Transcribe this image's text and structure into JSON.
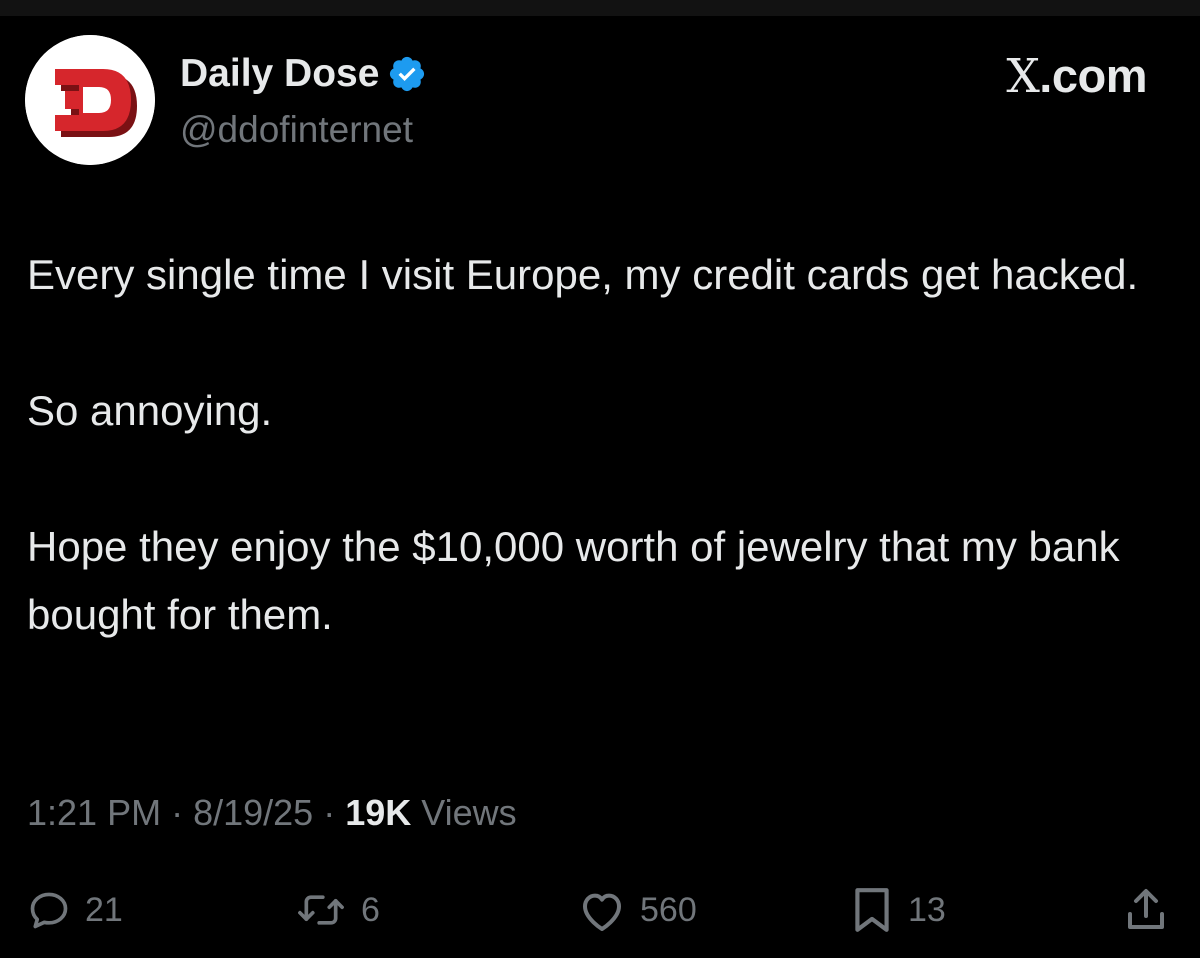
{
  "author": {
    "display_name": "Daily Dose",
    "handle": "@ddofinternet",
    "avatar_icon": "daily-dose-logo",
    "verified_icon": "verified-badge-icon",
    "verified_color": "#1d9bf0"
  },
  "brand": {
    "glyph": "X",
    "suffix": ".com"
  },
  "tweet": {
    "paragraphs": [
      "Every single time I visit Europe, my credit cards get hacked.",
      "So annoying.",
      "Hope they enjoy the $10,000 worth of jewelry that my bank bought for them."
    ]
  },
  "meta": {
    "time": "1:21 PM",
    "separator": " · ",
    "date": "8/19/25",
    "views_count": "19K",
    "views_label": " Views"
  },
  "actions": {
    "reply": {
      "icon": "reply-icon",
      "count": "21"
    },
    "repost": {
      "icon": "repost-icon",
      "count": "6"
    },
    "like": {
      "icon": "like-icon",
      "count": "560"
    },
    "bookmark": {
      "icon": "bookmark-icon",
      "count": "13"
    },
    "share": {
      "icon": "share-icon"
    }
  },
  "colors": {
    "background": "#000000",
    "text_primary": "#e7e9ea",
    "text_secondary": "#71767b",
    "logo_red": "#d6262c"
  }
}
